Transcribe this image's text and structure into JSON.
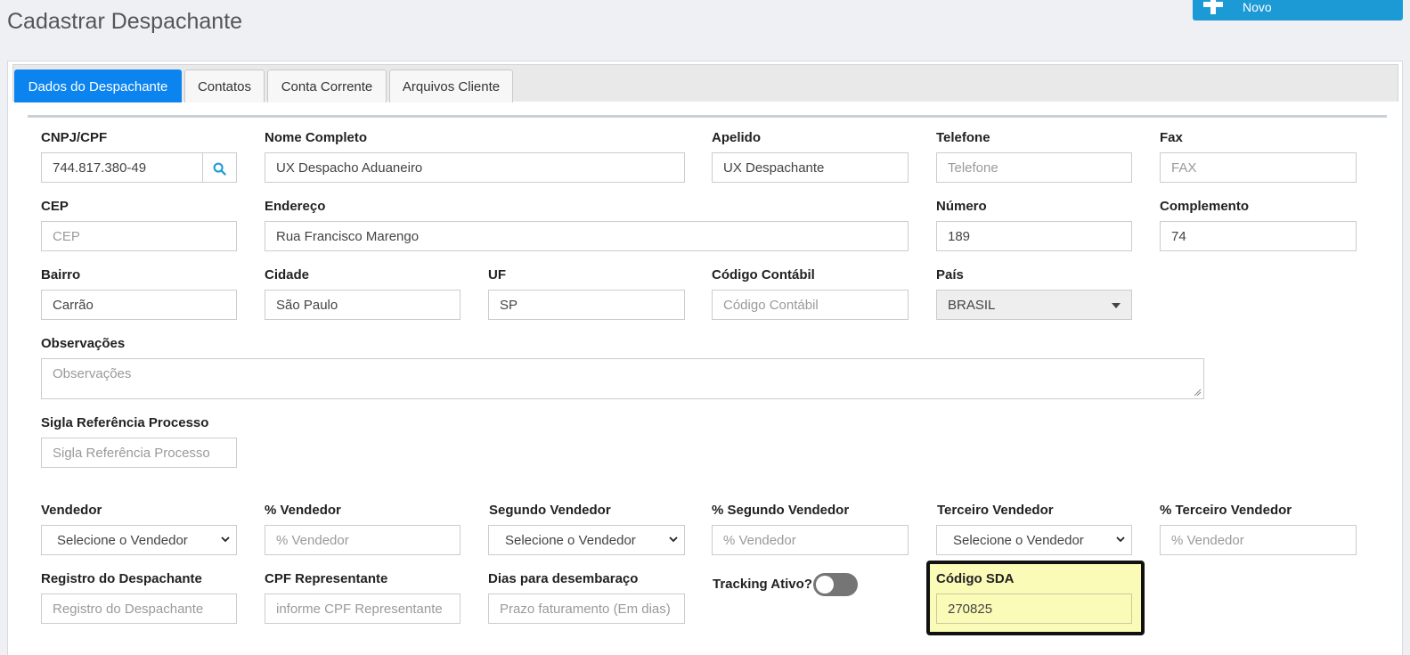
{
  "page": {
    "title": "Cadastrar Despachante"
  },
  "toolbar": {
    "new_label": "Novo"
  },
  "tabs": [
    {
      "label": "Dados do Despachante",
      "active": true
    },
    {
      "label": "Contatos",
      "active": false
    },
    {
      "label": "Conta Corrente",
      "active": false
    },
    {
      "label": "Arquivos Cliente",
      "active": false
    }
  ],
  "form": {
    "cnpj": {
      "label": "CNPJ/CPF",
      "value": "744.817.380-49"
    },
    "nome": {
      "label": "Nome Completo",
      "value": "UX Despacho Aduaneiro"
    },
    "apelido": {
      "label": "Apelido",
      "value": "UX Despachante"
    },
    "telefone": {
      "label": "Telefone",
      "placeholder": "Telefone"
    },
    "fax": {
      "label": "Fax",
      "placeholder": "FAX"
    },
    "cep": {
      "label": "CEP",
      "placeholder": "CEP"
    },
    "endereco": {
      "label": "Endereço",
      "value": "Rua Francisco Marengo"
    },
    "numero": {
      "label": "Número",
      "value": "189"
    },
    "complemento": {
      "label": "Complemento",
      "value": "74"
    },
    "bairro": {
      "label": "Bairro",
      "value": "Carrão"
    },
    "cidade": {
      "label": "Cidade",
      "value": "São Paulo"
    },
    "uf": {
      "label": "UF",
      "value": "SP"
    },
    "codigo_contabil": {
      "label": "Código Contábil",
      "placeholder": "Código Contábil"
    },
    "pais": {
      "label": "País",
      "value": "BRASIL"
    },
    "observacoes": {
      "label": "Observações",
      "placeholder": "Observações"
    },
    "sigla": {
      "label": "Sigla Referência Processo",
      "placeholder": "Sigla Referência Processo"
    },
    "vendedor": {
      "label": "Vendedor",
      "value": "Selecione o Vendedor"
    },
    "pct_vendedor": {
      "label": "% Vendedor",
      "placeholder": "% Vendedor"
    },
    "segundo_vendedor": {
      "label": "Segundo Vendedor",
      "value": "Selecione o Vendedor"
    },
    "pct_segundo": {
      "label": "% Segundo Vendedor",
      "placeholder": "% Vendedor"
    },
    "terceiro_vendedor": {
      "label": "Terceiro Vendedor",
      "value": "Selecione o Vendedor"
    },
    "pct_terceiro": {
      "label": "% Terceiro Vendedor",
      "placeholder": "% Vendedor"
    },
    "registro": {
      "label": "Registro do Despachante",
      "placeholder": "Registro do Despachante"
    },
    "cpf_rep": {
      "label": "CPF Representante",
      "placeholder": "informe CPF Representante"
    },
    "dias": {
      "label": "Dias para desembaraço",
      "placeholder": "Prazo faturamento (Em dias)"
    },
    "tracking": {
      "label": "Tracking Ativo?",
      "on": false
    },
    "codigo_sda": {
      "label": "Código SDA",
      "value": "270825"
    }
  },
  "colors": {
    "accent": "#0b84f0",
    "new_button": "#1c9ad6",
    "highlight": "#fbfbb8"
  },
  "icons": {
    "search": "search-icon",
    "new": "plus-icon",
    "dropdown": "chevron-down-icon"
  }
}
